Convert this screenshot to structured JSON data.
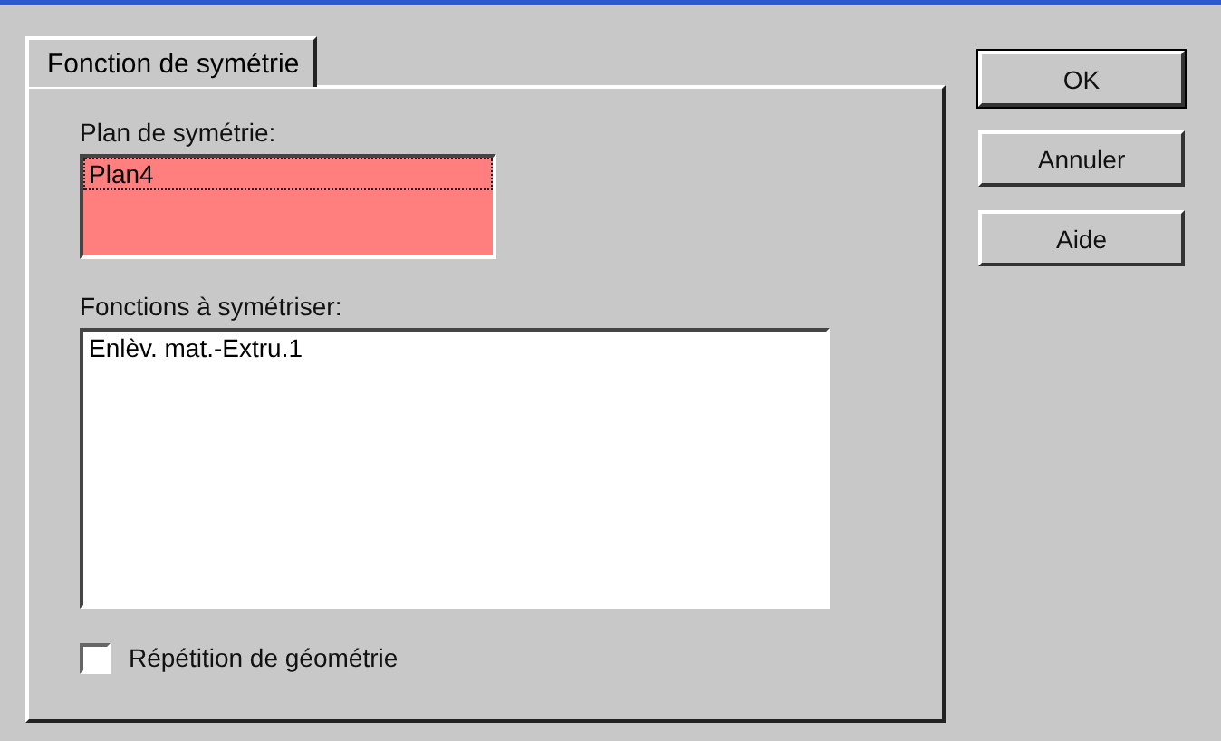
{
  "tabs": [
    {
      "label": "Fonction de symétrie",
      "selected": true
    }
  ],
  "plane": {
    "label": "Plan de symétrie:",
    "items": [
      {
        "label": "Plan4",
        "selected": true
      }
    ]
  },
  "features": {
    "label": "Fonctions à symétriser:",
    "items": [
      {
        "label": "Enlèv. mat.-Extru.1",
        "selected": false
      }
    ]
  },
  "geometry_pattern": {
    "label": "Répétition de géométrie",
    "checked": false
  },
  "buttons": [
    {
      "label": "OK",
      "default": true
    },
    {
      "label": "Annuler",
      "default": false
    },
    {
      "label": "Aide",
      "default": false
    }
  ]
}
